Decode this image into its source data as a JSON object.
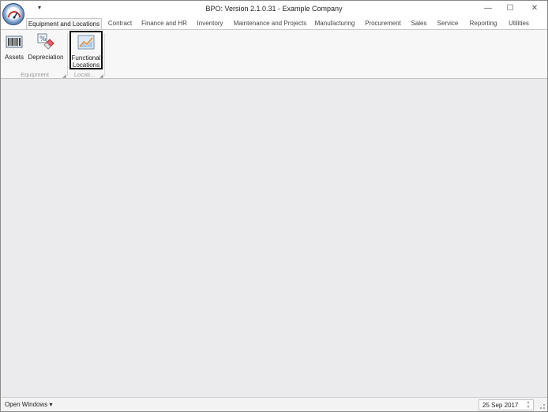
{
  "window": {
    "title": "BPO: Version 2.1.0.31 - Example Company",
    "qat_dropdown": "▾",
    "minimize": "—",
    "maximize": "☐",
    "close": "✕"
  },
  "tabs": [
    {
      "label": "Equipment and Locations",
      "active": true
    },
    {
      "label": "Contract"
    },
    {
      "label": "Finance and HR"
    },
    {
      "label": "Inventory"
    },
    {
      "label": "Maintenance and Projects"
    },
    {
      "label": "Manufacturing"
    },
    {
      "label": "Procurement"
    },
    {
      "label": "Sales"
    },
    {
      "label": "Service"
    },
    {
      "label": "Reporting"
    },
    {
      "label": "Utilities"
    }
  ],
  "ribbon": {
    "groups": [
      {
        "label": "Equipment",
        "buttons": [
          {
            "label": "Assets",
            "icon": "barcode-icon"
          },
          {
            "label": "Depreciation",
            "icon": "percent-eraser-icon"
          }
        ]
      },
      {
        "label": "Locati...",
        "buttons": [
          {
            "label_line1": "Functional",
            "label_line2": "Locations",
            "icon": "chart-map-icon",
            "selected": true
          }
        ]
      }
    ],
    "launcher": "◢"
  },
  "statusbar": {
    "open_windows": "Open Windows ▾",
    "date": "25 Sep 2017",
    "spin_up": "▲",
    "spin_down": "▼"
  }
}
